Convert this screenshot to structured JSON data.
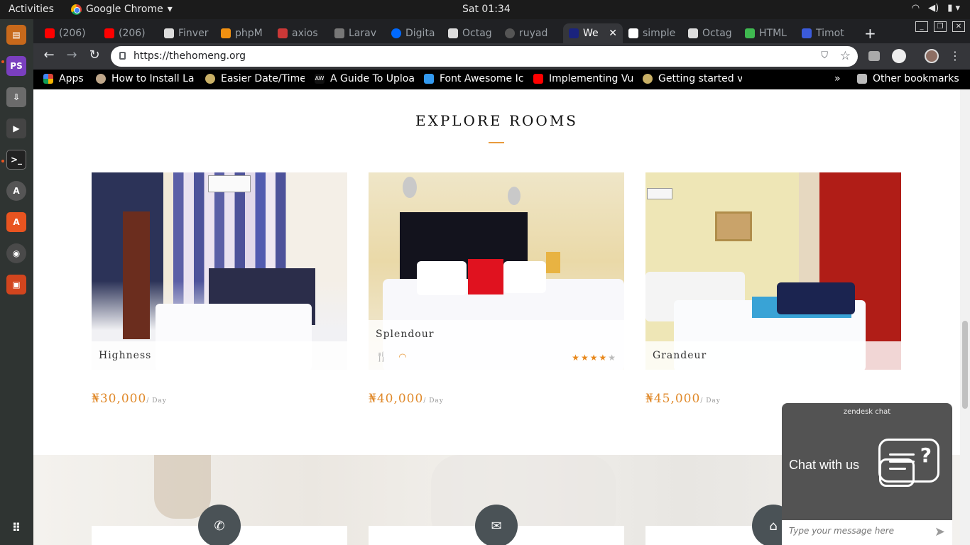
{
  "topbar": {
    "activities": "Activities",
    "app": "Google Chrome",
    "clock": "Sat 01:34"
  },
  "tabs": [
    {
      "label": "(206)",
      "color": "#ff0000"
    },
    {
      "label": "(206)",
      "color": "#ff0000"
    },
    {
      "label": "Finver",
      "color": "#dddddd"
    },
    {
      "label": "phpM",
      "color": "#f29111"
    },
    {
      "label": "axios",
      "color": "#cb3837"
    },
    {
      "label": "Larav",
      "color": "#777777"
    },
    {
      "label": "Digita",
      "color": "#0069ff"
    },
    {
      "label": "Octag",
      "color": "#dddddd"
    },
    {
      "label": "ruyad",
      "color": "#555555"
    },
    {
      "label": "We",
      "color": "#1a237e",
      "active": true
    },
    {
      "label": "simple",
      "color": "#ffffff"
    },
    {
      "label": "Octag",
      "color": "#dddddd"
    },
    {
      "label": "HTML",
      "color": "#3fb950"
    },
    {
      "label": "Timot",
      "color": "#3b5bdb"
    }
  ],
  "omnibox": {
    "url": "https://thehomeng.org"
  },
  "bookmarks": [
    {
      "label": "Apps"
    },
    {
      "label": "How to Install La"
    },
    {
      "label": "Easier Date/Time"
    },
    {
      "label": "A Guide To Uploa"
    },
    {
      "label": "Font Awesome Ic"
    },
    {
      "label": "Implementing Vu"
    },
    {
      "label": "Getting started v"
    }
  ],
  "bookmarks_more": "»",
  "other_bookmarks": "Other bookmarks",
  "section": {
    "title": "EXPLORE ROOMS"
  },
  "rooms": [
    {
      "name": "Highness",
      "price": "₦30,000",
      "per": "/ Day"
    },
    {
      "name": "Splendour",
      "price": "₦40,000",
      "per": "/ Day",
      "rating": 4,
      "max_rating": 5
    },
    {
      "name": "Grandeur",
      "price": "₦45,000",
      "per": "/ Day"
    }
  ],
  "contact_icons": [
    "phone-icon",
    "envelope-icon",
    "home-icon"
  ],
  "chat": {
    "brand": "zendesk chat",
    "cta": "Chat with us",
    "placeholder": "Type your message here"
  },
  "colors": {
    "accent": "#e89a3c",
    "price": "#e0892a"
  }
}
